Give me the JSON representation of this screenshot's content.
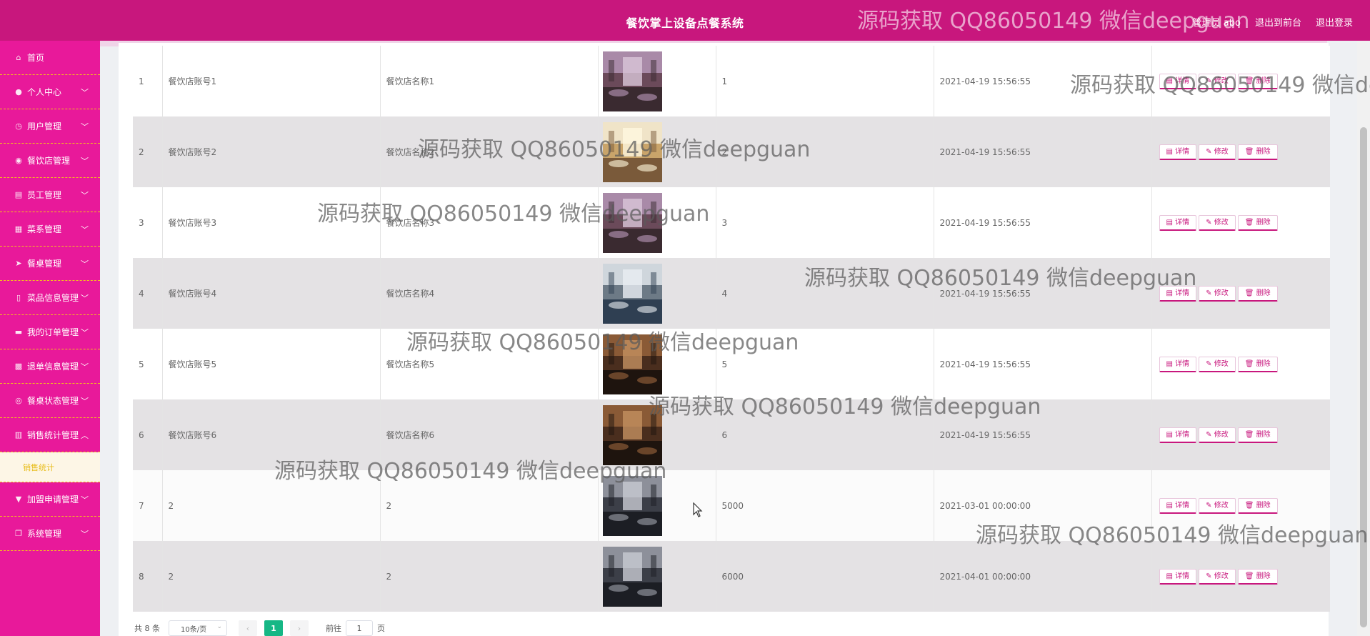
{
  "header": {
    "title": "餐饮掌上设备点餐系统",
    "user_label": "管理员 abo",
    "to_front": "退出到前台",
    "logout": "退出登录"
  },
  "sidebar": {
    "items": [
      {
        "label": "首页",
        "icon": "home-icon",
        "glyph": "⌂",
        "has_chevron": false
      },
      {
        "label": "个人中心",
        "icon": "user-icon",
        "glyph": "●",
        "has_chevron": true
      },
      {
        "label": "用户管理",
        "icon": "clock-icon",
        "glyph": "◷",
        "has_chevron": true
      },
      {
        "label": "餐饮店管理",
        "icon": "location-icon",
        "glyph": "◉",
        "has_chevron": true
      },
      {
        "label": "员工管理",
        "icon": "id-card-icon",
        "glyph": "▤",
        "has_chevron": true
      },
      {
        "label": "菜系管理",
        "icon": "grid-icon",
        "glyph": "▦",
        "has_chevron": true
      },
      {
        "label": "餐桌管理",
        "icon": "send-icon",
        "glyph": "➤",
        "has_chevron": true
      },
      {
        "label": "菜品信息管理",
        "icon": "lock-icon",
        "glyph": "▯",
        "has_chevron": true
      },
      {
        "label": "我的订单管理",
        "icon": "monitor-icon",
        "glyph": "▬",
        "has_chevron": true
      },
      {
        "label": "退单信息管理",
        "icon": "apps-icon",
        "glyph": "▩",
        "has_chevron": true
      },
      {
        "label": "餐桌状态管理",
        "icon": "check-circle-icon",
        "glyph": "◎",
        "has_chevron": true
      },
      {
        "label": "销售统计管理",
        "icon": "bar-chart-icon",
        "glyph": "▥",
        "has_chevron": true,
        "expanded": true
      },
      {
        "label": "加盟申请管理",
        "icon": "pin-icon",
        "glyph": "▼",
        "has_chevron": true
      },
      {
        "label": "系统管理",
        "icon": "copy-icon",
        "glyph": "❐",
        "has_chevron": true
      }
    ],
    "submenu": {
      "label": "销售统计"
    }
  },
  "actions": {
    "detail": "详情",
    "edit": "修改",
    "delete": "删除"
  },
  "rows": [
    {
      "idx": "1",
      "account": "餐饮店账号1",
      "name": "餐饮店名称1",
      "number": "1",
      "time": "2021-04-19 15:56:55",
      "palette": "a"
    },
    {
      "idx": "2",
      "account": "餐饮店账号2",
      "name": "餐饮店名称2",
      "number": "2",
      "time": "2021-04-19 15:56:55",
      "palette": "b"
    },
    {
      "idx": "3",
      "account": "餐饮店账号3",
      "name": "餐饮店名称3",
      "number": "3",
      "time": "2021-04-19 15:56:55",
      "palette": "a"
    },
    {
      "idx": "4",
      "account": "餐饮店账号4",
      "name": "餐饮店名称4",
      "number": "4",
      "time": "2021-04-19 15:56:55",
      "palette": "c"
    },
    {
      "idx": "5",
      "account": "餐饮店账号5",
      "name": "餐饮店名称5",
      "number": "5",
      "time": "2021-04-19 15:56:55",
      "palette": "d"
    },
    {
      "idx": "6",
      "account": "餐饮店账号6",
      "name": "餐饮店名称6",
      "number": "6",
      "time": "2021-04-19 15:56:55",
      "palette": "d"
    },
    {
      "idx": "7",
      "account": "2",
      "name": "2",
      "number": "5000",
      "time": "2021-03-01 00:00:00",
      "palette": "e"
    },
    {
      "idx": "8",
      "account": "2",
      "name": "2",
      "number": "6000",
      "time": "2021-04-01 00:00:00",
      "palette": "e"
    }
  ],
  "pagination": {
    "total": "共 8 条",
    "page_size": "10条/页",
    "prev": "‹",
    "current": "1",
    "next": "›",
    "goto_prefix": "前往",
    "goto_value": "1",
    "goto_suffix": "页"
  },
  "watermark": "源码获取 QQ86050149 微信deepguan",
  "colors": {
    "topbar": "#c8177d",
    "sidebar": "#e8199a",
    "divider": "#f4c21a",
    "active_page": "#16b785"
  }
}
